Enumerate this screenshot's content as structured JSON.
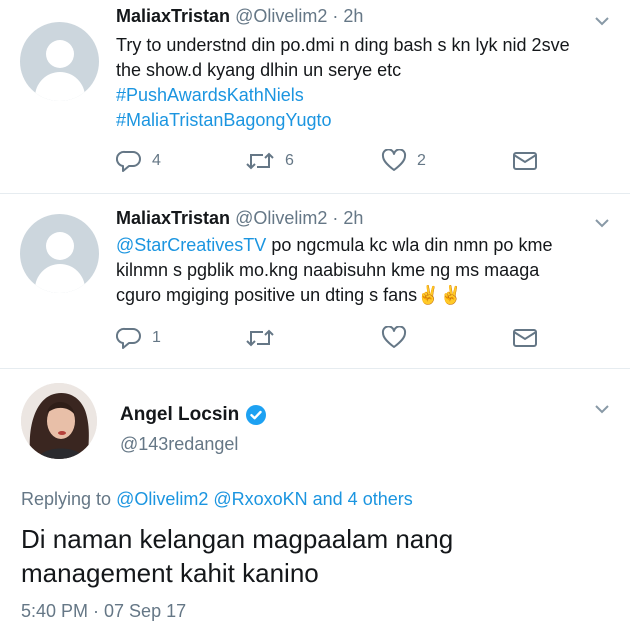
{
  "tweets": [
    {
      "name": "MaliaxTristan",
      "handle": "@Olivelim2",
      "time": " · 2h",
      "line1": "Try to understnd din po.dmi n ding bash s kn lyk nid 2sve",
      "line2": "the show.d kyang dlhin un serye etc",
      "hashtag1": "#PushAwardsKathNiels",
      "hashtag2": "#MaliaTristanBagongYugto",
      "replies": "4",
      "retweets": "6",
      "likes": "2"
    },
    {
      "name": "MaliaxTristan",
      "handle": "@Olivelim2",
      "time": " · 2h",
      "mention": "@StarCreativesTV",
      "line1_rest": " po ngcmula kc wla din nmn po kme",
      "line2": "kilnmn s pgblik mo.kng naabisuhn kme ng ms maaga",
      "line3": "cguro mgiging positive un dting s fans✌️✌️",
      "replies": "1",
      "retweets": "",
      "likes": ""
    }
  ],
  "main_tweet": {
    "name": "Angel Locsin",
    "handle": "@143redangel",
    "verified": true,
    "replying_prefix": "Replying to ",
    "replying_users": "@Olivelim2 @RxoxoKN and 4 others",
    "text": "Di naman kelangan magpaalam nang management kahit kanino",
    "timestamp": "5:40 PM · 07 Sep 17"
  },
  "colors": {
    "link": "#1b95e0",
    "secondary_text": "#657786",
    "verified_badge": "#1da1f2",
    "default_avatar": "#ccd6dd"
  },
  "icons": [
    "reply-icon",
    "retweet-icon",
    "like-icon",
    "direct-message-icon",
    "chevron-down-icon",
    "verified-badge-icon"
  ]
}
